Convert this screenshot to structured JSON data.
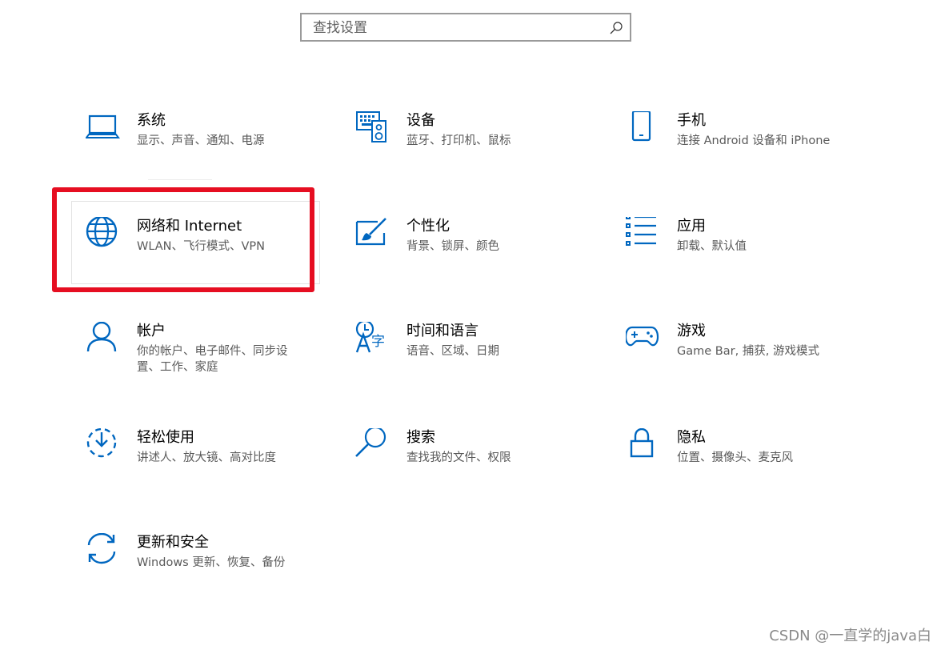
{
  "search": {
    "placeholder": "查找设置",
    "icon": "search-icon"
  },
  "accent_color": "#0067c0",
  "highlight_color": "#e60e21",
  "tiles": [
    {
      "title": "系统",
      "desc": "显示、声音、通知、电源",
      "icon": "laptop-icon"
    },
    {
      "title": "设备",
      "desc": "蓝牙、打印机、鼠标",
      "icon": "keyboard-speaker-icon"
    },
    {
      "title": "手机",
      "desc": "连接 Android 设备和 iPhone",
      "icon": "phone-icon"
    },
    {
      "title": "网络和 Internet",
      "desc": "WLAN、飞行模式、VPN",
      "icon": "globe-icon"
    },
    {
      "title": "个性化",
      "desc": "背景、锁屏、颜色",
      "icon": "paint-brush-icon"
    },
    {
      "title": "应用",
      "desc": "卸载、默认值",
      "icon": "apps-list-icon"
    },
    {
      "title": "帐户",
      "desc": "你的帐户、电子邮件、同步设置、工作、家庭",
      "icon": "person-icon"
    },
    {
      "title": "时间和语言",
      "desc": "语音、区域、日期",
      "icon": "time-language-icon"
    },
    {
      "title": "游戏",
      "desc": "Game Bar, 捕获, 游戏模式",
      "icon": "gamepad-icon"
    },
    {
      "title": "轻松使用",
      "desc": "讲述人、放大镜、高对比度",
      "icon": "ease-of-access-icon"
    },
    {
      "title": "搜索",
      "desc": "查找我的文件、权限",
      "icon": "magnifier-icon"
    },
    {
      "title": "隐私",
      "desc": "位置、摄像头、麦克风",
      "icon": "lock-icon"
    },
    {
      "title": "更新和安全",
      "desc": "Windows 更新、恢复、备份",
      "icon": "sync-icon"
    }
  ],
  "watermark": "CSDN @一直学的java白"
}
